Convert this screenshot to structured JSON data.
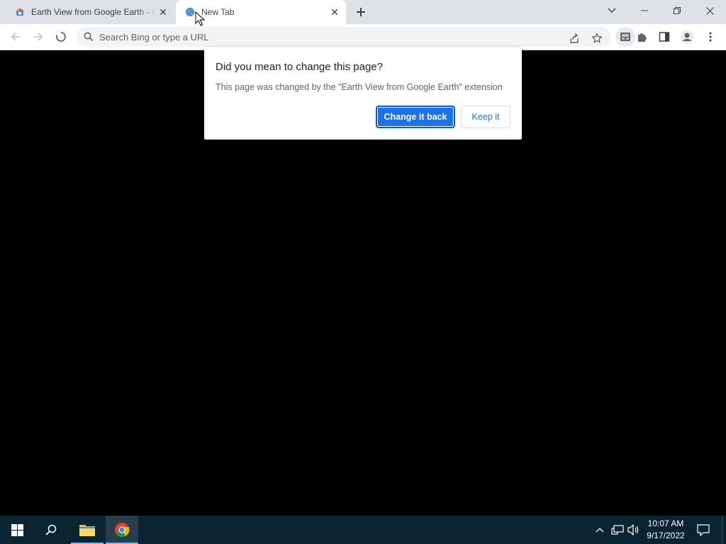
{
  "browser": {
    "tabs": [
      {
        "title": "Earth View from Google Earth - Chrome Web Store",
        "active": false,
        "favicon": "chrome-web-store-icon"
      },
      {
        "title": "New Tab",
        "active": true,
        "favicon": "earth-view-icon"
      }
    ],
    "omnibox": {
      "placeholder": "Search Bing or type a URL",
      "value": ""
    }
  },
  "dialog": {
    "title": "Did you mean to change this page?",
    "body": "This page was changed by the \"Earth View from Google Earth\" extension",
    "primary_button": "Change it back",
    "secondary_button": "Keep it"
  },
  "taskbar": {
    "time": "10:07 AM",
    "date": "9/17/2022"
  },
  "colors": {
    "accent": "#1a73e8",
    "tabstrip": "#dee1e6",
    "page_background": "#000000",
    "taskbar": "#0b2431"
  }
}
